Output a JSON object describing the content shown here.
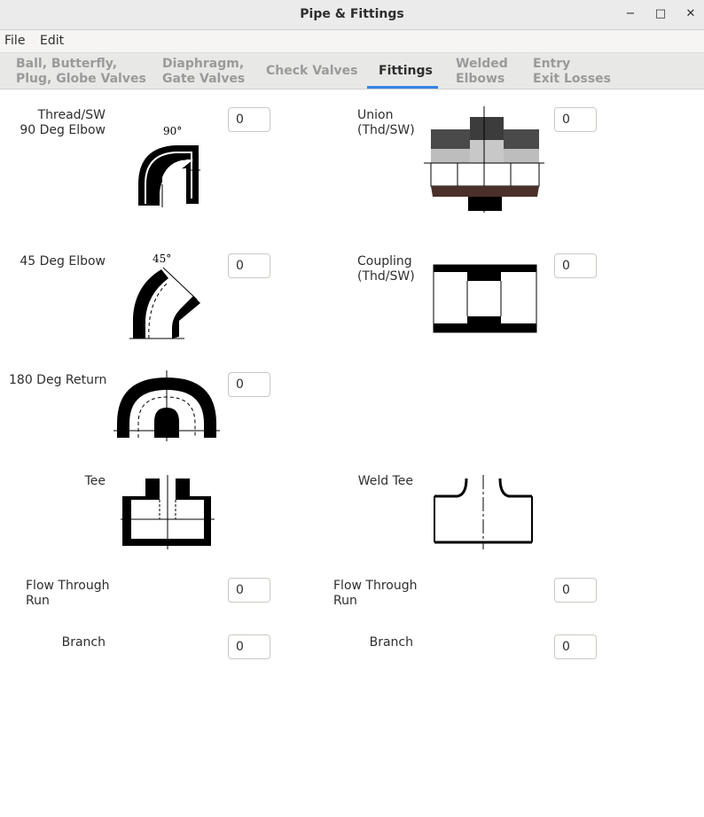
{
  "window": {
    "title": "Pipe & Fittings"
  },
  "menu": {
    "file": "File",
    "edit": "Edit"
  },
  "tabs": [
    {
      "line1": "Ball, Butterfly,",
      "line2": "Plug, Globe Valves"
    },
    {
      "line1": "Diaphragm,",
      "line2": "Gate Valves"
    },
    {
      "line1": "Check Valves",
      "line2": ""
    },
    {
      "line1": "Fittings",
      "line2": ""
    },
    {
      "line1": "Welded",
      "line2": "Elbows"
    },
    {
      "line1": "Entry",
      "line2": "Exit Losses"
    }
  ],
  "active_tab": "Fittings",
  "fittings": {
    "elbow90": {
      "label1": "Thread/SW",
      "label2": "90 Deg Elbow",
      "angle": "90°",
      "value": "0"
    },
    "union": {
      "label1": "Union",
      "label2": "(Thd/SW)",
      "value": "0"
    },
    "elbow45": {
      "label": "45 Deg Elbow",
      "angle": "45°",
      "value": "0"
    },
    "coupling": {
      "label1": "Coupling",
      "label2": "(Thd/SW)",
      "value": "0"
    },
    "return180": {
      "label": "180 Deg Return",
      "value": "0"
    },
    "tee": {
      "label": "Tee"
    },
    "weld_tee": {
      "label": "Weld Tee"
    },
    "tee_run": {
      "label1": "Flow Through",
      "label2": "Run",
      "value": "0"
    },
    "tee_branch": {
      "label": "Branch",
      "value": "0"
    },
    "weld_run": {
      "label1": "Flow Through",
      "label2": "Run",
      "value": "0"
    },
    "weld_branch": {
      "label": "Branch",
      "value": "0"
    }
  }
}
